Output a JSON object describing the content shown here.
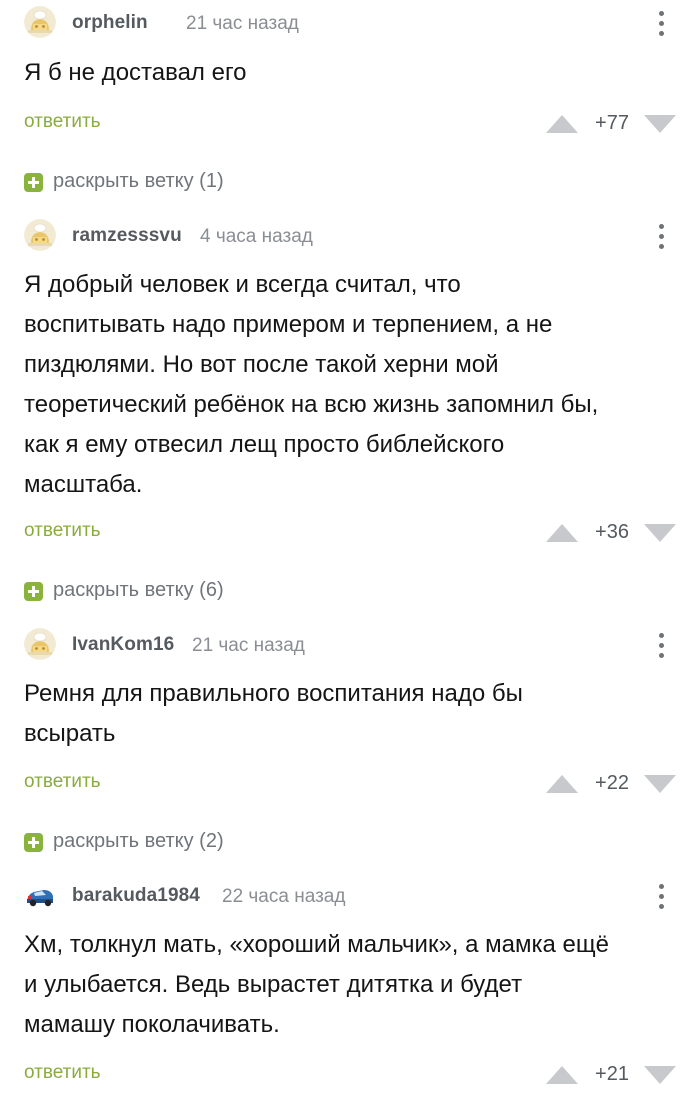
{
  "reply_label": "ответить",
  "colors": {
    "accent": "#8aac3e",
    "plus_badge": "#8ab33e",
    "meta": "#8a8e93",
    "username": "#555a5f"
  },
  "comments": [
    {
      "username": "orphelin",
      "time": "21 час назад",
      "avatar_icon": "user-avatar-default-icon",
      "text": "Я б не доставал его",
      "score": "+77",
      "expand": "раскрыть ветку (1)"
    },
    {
      "username": "ramzesssvu",
      "time": "4 часа назад",
      "avatar_icon": "user-avatar-default-icon",
      "text": "Я добрый человек и всегда считал, что\nвоспитывать надо примером и терпением, а не\nпиздюлями. Но вот после такой херни мой\nтеоретический ребёнок на всю жизнь запомнил бы,\nкак я ему отвесил лещ просто библейского\nмасштаба.",
      "score": "+36",
      "expand": "раскрыть ветку (6)"
    },
    {
      "username": "IvanKom16",
      "time": "21 час назад",
      "avatar_icon": "user-avatar-default-icon",
      "text": "Ремня для правильного воспитания надо бы\nвсырать",
      "score": "+22",
      "expand": "раскрыть ветку (2)"
    },
    {
      "username": "barakuda1984",
      "time": "22 часа назад",
      "avatar_icon": "user-avatar-car-icon",
      "text": "Хм, толкнул мать, «хороший мальчик», а мамка ещё\nи улыбается. Ведь вырастет дитятка и будет\nмамашу поколачивать.",
      "score": "+21"
    }
  ]
}
